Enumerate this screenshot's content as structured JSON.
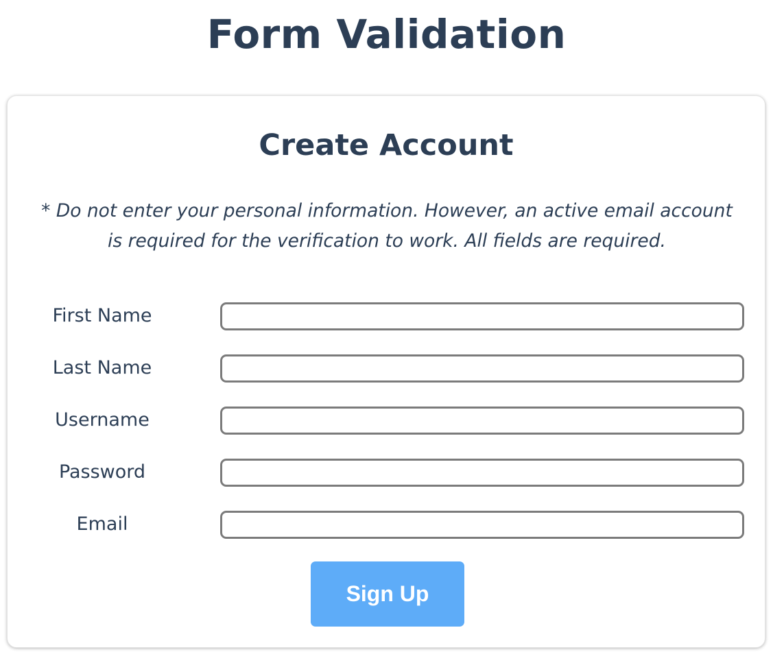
{
  "page": {
    "title": "Form Validation"
  },
  "form": {
    "title": "Create Account",
    "notice": "* Do not enter your personal information. However, an active email account is required for the verification to work. All fields are required.",
    "fields": [
      {
        "label": "First Name",
        "value": ""
      },
      {
        "label": "Last Name",
        "value": ""
      },
      {
        "label": "Username",
        "value": ""
      },
      {
        "label": "Password",
        "value": ""
      },
      {
        "label": "Email",
        "value": ""
      }
    ],
    "submit_label": "Sign Up"
  },
  "colors": {
    "text": "#2c3e55",
    "button": "#5eacf8",
    "input_border": "#7b7b7b"
  }
}
